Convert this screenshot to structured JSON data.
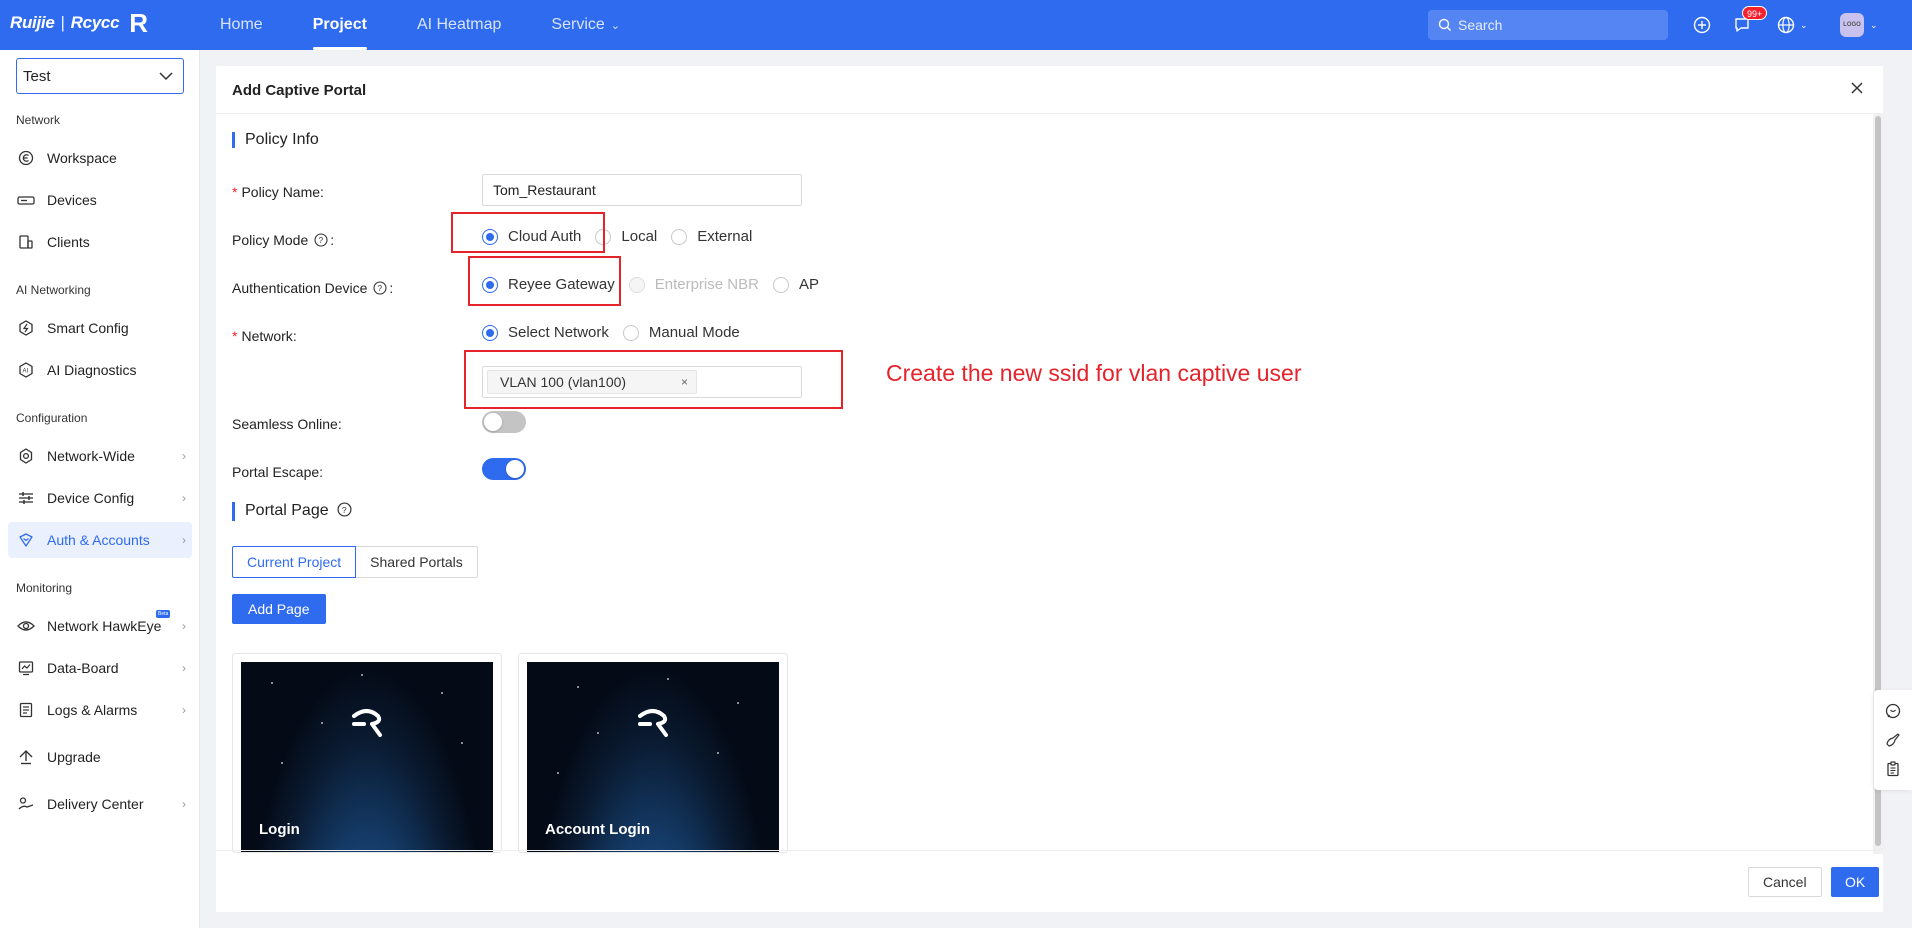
{
  "brand": {
    "name": "Ruijie",
    "separator": "|",
    "sub": "Rcycc",
    "mark": "R"
  },
  "nav": [
    {
      "label": "Home",
      "active": false
    },
    {
      "label": "Project",
      "active": true
    },
    {
      "label": "AI Heatmap",
      "active": false
    },
    {
      "label": "Service",
      "active": false
    }
  ],
  "topbar": {
    "search_placeholder": "Search",
    "notification_badge": "99+",
    "avatar_text": "LOGO"
  },
  "sidebar": {
    "project_selected": "Test",
    "sections": [
      {
        "title": "Network",
        "items": [
          {
            "label": "Workspace",
            "icon": "workspace-icon"
          },
          {
            "label": "Devices",
            "icon": "devices-icon"
          },
          {
            "label": "Clients",
            "icon": "clients-icon"
          }
        ]
      },
      {
        "title": "AI Networking",
        "items": [
          {
            "label": "Smart Config",
            "icon": "smart-config-icon"
          },
          {
            "label": "AI Diagnostics",
            "icon": "ai-diagnostics-icon"
          }
        ]
      },
      {
        "title": "Configuration",
        "items": [
          {
            "label": "Network-Wide",
            "icon": "gear-icon"
          },
          {
            "label": "Device Config",
            "icon": "sliders-icon"
          },
          {
            "label": "Auth & Accounts",
            "icon": "shield-icon",
            "active": true
          }
        ]
      },
      {
        "title": "Monitoring",
        "items": [
          {
            "label": "Network HawkEye",
            "icon": "eye-icon",
            "badge": "Beta"
          },
          {
            "label": "Data-Board",
            "icon": "dashboard-icon"
          },
          {
            "label": "Logs & Alarms",
            "icon": "logs-icon"
          }
        ]
      }
    ],
    "upgrade": "Upgrade",
    "delivery": "Delivery Center"
  },
  "modal": {
    "title": "Add Captive Portal",
    "policy_info": "Policy Info",
    "policy_name_label": "Policy Name",
    "policy_name_value": "Tom_Restaurant",
    "policy_mode_label": "Policy Mode",
    "policy_modes": [
      "Cloud Auth",
      "Local",
      "External"
    ],
    "auth_device_label": "Authentication Device",
    "auth_devices": [
      "Reyee Gateway",
      "Enterprise NBR",
      "AP"
    ],
    "network_label": "Network",
    "network_modes": [
      "Select Network",
      "Manual Mode"
    ],
    "network_tag": "VLAN 100 (vlan100)",
    "seamless_label": "Seamless Online",
    "seamless_on": false,
    "escape_label": "Portal Escape",
    "escape_on": true,
    "portal_page": "Portal Page",
    "portal_tabs": [
      "Current Project",
      "Shared Portals"
    ],
    "add_page": "Add Page",
    "cards": [
      {
        "caption": "Login"
      },
      {
        "caption": "Account Login"
      }
    ],
    "cancel": "Cancel",
    "ok": "OK"
  },
  "annotation": {
    "text": "Create the new ssid for vlan captive user",
    "color": "#e5232b"
  },
  "colors": {
    "primary": "#2f6bef",
    "annotation": "#e5232b"
  }
}
